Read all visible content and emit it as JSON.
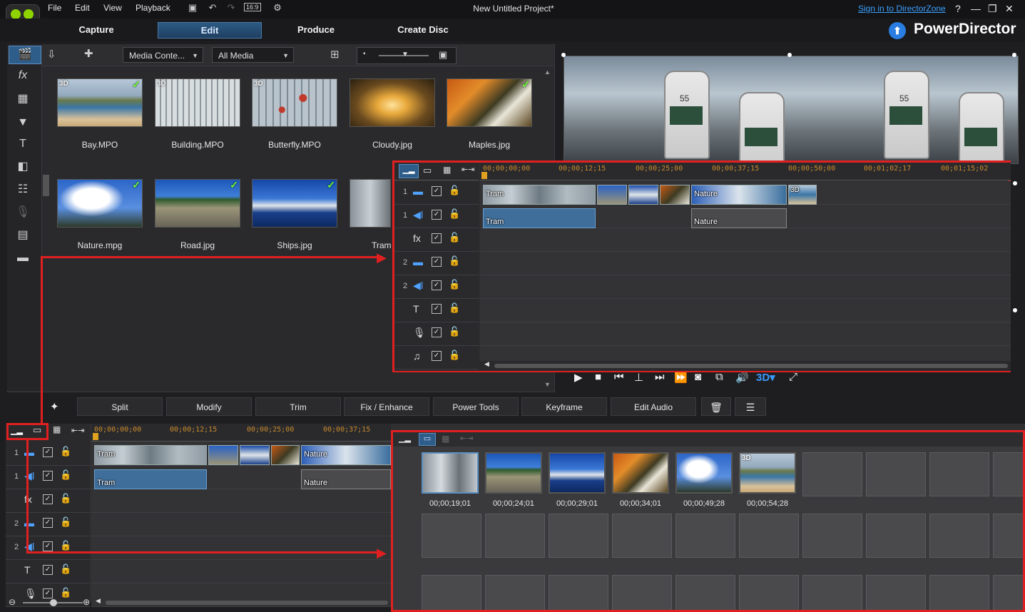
{
  "app": {
    "title": "New Untitled Project*",
    "brand": "PowerDirector",
    "signin": "Sign in to DirectorZone",
    "menus": [
      "File",
      "Edit",
      "View",
      "Playback"
    ],
    "aspect": "16:9"
  },
  "modes": [
    "Capture",
    "Edit",
    "Produce",
    "Create Disc"
  ],
  "active_mode": "Edit",
  "library": {
    "filter1": "Media Conte...",
    "filter2": "All Media",
    "items": [
      {
        "label": "Bay.MPO",
        "badge": "3D",
        "checked": true
      },
      {
        "label": "Building.MPO",
        "badge": "3D",
        "checked": false
      },
      {
        "label": "Butterfly.MPO",
        "badge": "3D",
        "checked": false
      },
      {
        "label": "Cloudy.jpg",
        "badge": "",
        "checked": false
      },
      {
        "label": "Maples.jpg",
        "badge": "",
        "checked": true
      },
      {
        "label": "Nature.mpg",
        "badge": "",
        "checked": true
      },
      {
        "label": "Road.jpg",
        "badge": "",
        "checked": true
      },
      {
        "label": "Ships.jpg",
        "badge": "",
        "checked": true
      },
      {
        "label": "Tram",
        "badge": "",
        "checked": false
      }
    ]
  },
  "edit_tools": [
    "Split",
    "Modify",
    "Trim",
    "Fix / Enhance",
    "Power Tools",
    "Keyframe",
    "Edit Audio"
  ],
  "timeline_zoomed": {
    "ruler": [
      "00;00;00;00",
      "00;00;12;15",
      "00;00;25;00",
      "00;00;37;15",
      "00;00;50;00",
      "00;01;02;17",
      "00;01;15;02"
    ],
    "tracks": [
      {
        "num": "1",
        "icon": "video-track-icon"
      },
      {
        "num": "1",
        "icon": "audio-track-icon"
      },
      {
        "num": "",
        "icon": "fx-track-icon"
      },
      {
        "num": "2",
        "icon": "video-track-icon"
      },
      {
        "num": "2",
        "icon": "audio-track-icon"
      },
      {
        "num": "",
        "icon": "title-track-icon"
      },
      {
        "num": "",
        "icon": "voice-track-icon"
      },
      {
        "num": "",
        "icon": "music-track-icon"
      }
    ],
    "clips": {
      "tram_video": "Tram",
      "tram_audio": "Tram",
      "nature_video": "Nature",
      "nature_audio": "Nature",
      "badge": "3D"
    }
  },
  "timeline_bottom": {
    "ruler": [
      "00;00;00;00",
      "00;00;12;15",
      "00;00;25;00",
      "00;00;37;15"
    ],
    "tracks": [
      {
        "num": "1",
        "icon": "video-track-icon"
      },
      {
        "num": "1",
        "icon": "audio-track-icon"
      },
      {
        "num": "",
        "icon": "fx-track-icon"
      },
      {
        "num": "2",
        "icon": "video-track-icon"
      },
      {
        "num": "2",
        "icon": "audio-track-icon"
      },
      {
        "num": "",
        "icon": "title-track-icon"
      },
      {
        "num": "",
        "icon": "voice-track-icon"
      }
    ],
    "clips": {
      "tram_video": "Tram",
      "tram_audio": "Tram",
      "nature_video": "Nature",
      "nature_audio": "Nature"
    }
  },
  "storyboard": {
    "times": [
      "00;00;19;01",
      "00;00;24;01",
      "00;00;29;01",
      "00;00;34;01",
      "00;00;49;28",
      "00;00;54;28"
    ],
    "badge": "3D"
  },
  "colors": {
    "accent": "#2a7de0",
    "highlight": "#e02020",
    "timecode": "#c98a2a"
  }
}
